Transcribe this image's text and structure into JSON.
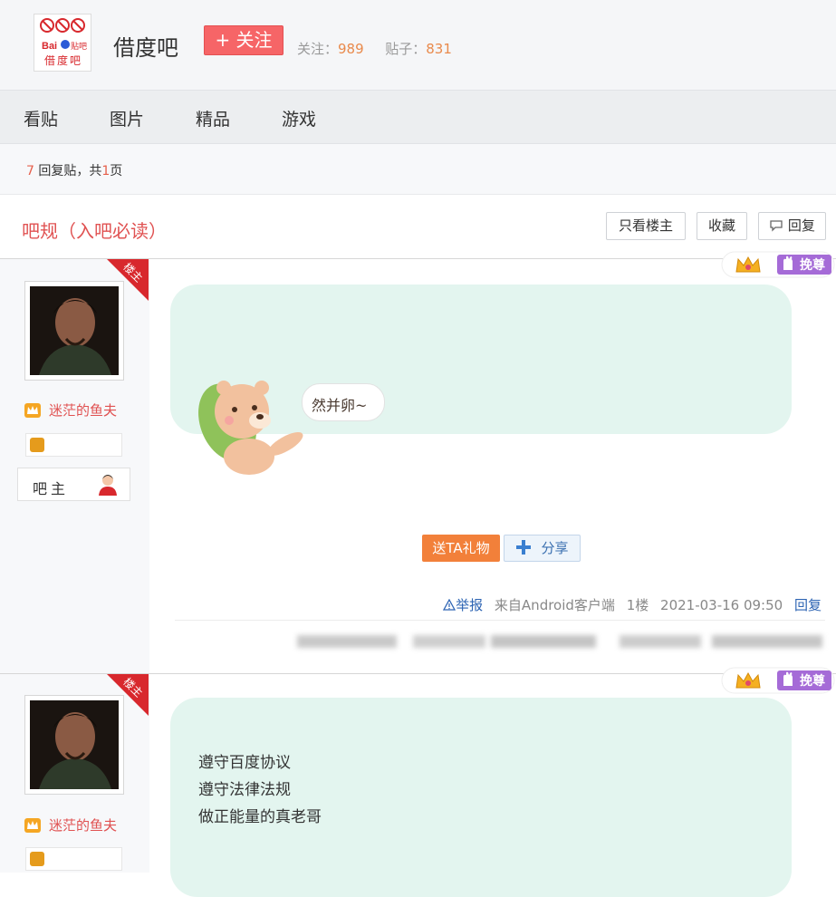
{
  "header": {
    "logo_text": "借度吧",
    "forum_name": "借度吧",
    "follow_label": "+ 关注",
    "follow_count_label": "关注：",
    "follow_count": "989",
    "post_count_label": "贴子：",
    "post_count": "831"
  },
  "tabs": [
    "看贴",
    "图片",
    "精品",
    "游戏"
  ],
  "pager": {
    "reply_count": "7",
    "reply_label": " 回复贴，共",
    "page_count": "1",
    "page_label": "页"
  },
  "thread": {
    "title": "吧规（入吧必读）",
    "only_op_label": "只看楼主",
    "favorite_label": "收藏",
    "reply_label": "回复"
  },
  "posts": [
    {
      "op_tag": "楼主",
      "username": "迷茫的鱼夫",
      "role": "吧主",
      "badge": "挽尊",
      "sticker_text": "然并卵~",
      "gift_label": "送TA礼物",
      "share_label": "分享",
      "report_label": "举报",
      "source": "来自Android客户端",
      "floor": "1楼",
      "time": "2021-03-16 09:50",
      "reply_label": "回复"
    },
    {
      "op_tag": "楼主",
      "username": "迷茫的鱼夫",
      "badge": "挽尊",
      "lines": [
        "遵守百度协议",
        "遵守法律法规",
        "做正能量的真老哥"
      ]
    }
  ],
  "colors": {
    "accent_red": "#e05252",
    "follow_btn": "#f66567",
    "gift_btn": "#f2803a",
    "link_blue": "#2d64b3"
  }
}
